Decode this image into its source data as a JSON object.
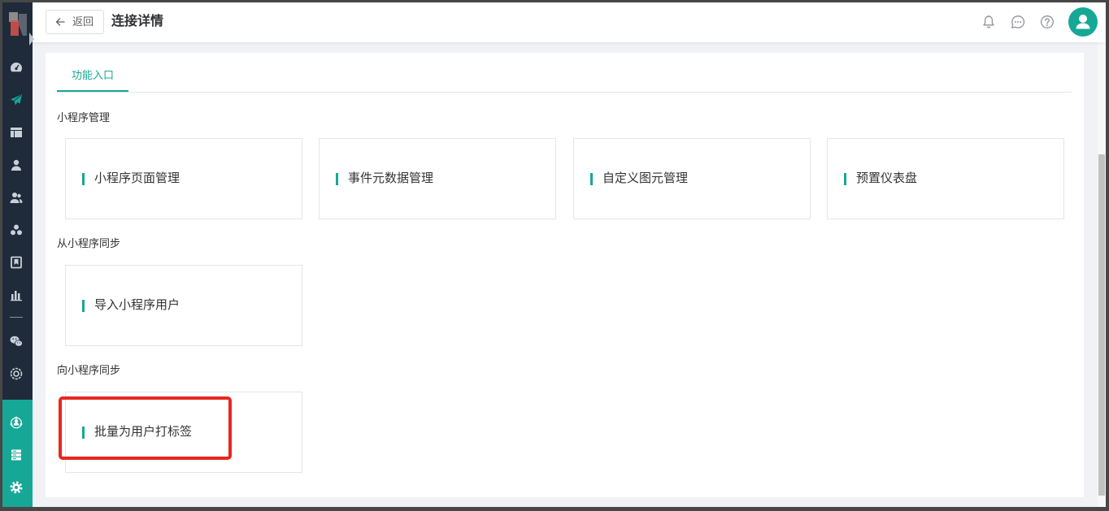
{
  "sidebar": {
    "nav_items": [
      {
        "icon": "dashboard-icon",
        "active": false
      },
      {
        "icon": "paper-plane-icon",
        "active": true
      },
      {
        "icon": "layout-icon",
        "active": false
      },
      {
        "icon": "user-icon",
        "active": false
      },
      {
        "icon": "users-icon",
        "active": false
      },
      {
        "icon": "cluster-icon",
        "active": false
      },
      {
        "icon": "bookmark-icon",
        "active": false
      },
      {
        "icon": "bar-chart-icon",
        "active": false
      },
      {
        "icon": "wechat-icon",
        "active": false
      },
      {
        "icon": "target-icon",
        "active": false
      }
    ],
    "bottom_items": [
      {
        "icon": "network-icon"
      },
      {
        "icon": "server-icon"
      },
      {
        "icon": "gear-icon"
      }
    ]
  },
  "header": {
    "back_label": "返回",
    "title": "连接详情",
    "actions": [
      {
        "icon": "bell-icon"
      },
      {
        "icon": "chat-icon"
      },
      {
        "icon": "help-icon"
      },
      {
        "icon": "avatar-icon"
      }
    ]
  },
  "tabs": [
    {
      "label": "功能入口",
      "active": true
    }
  ],
  "sections": [
    {
      "title": "小程序管理",
      "cards": [
        {
          "label": "小程序页面管理"
        },
        {
          "label": "事件元数据管理"
        },
        {
          "label": "自定义图元管理"
        },
        {
          "label": "预置仪表盘"
        }
      ]
    },
    {
      "title": "从小程序同步",
      "cards": [
        {
          "label": "导入小程序用户"
        }
      ]
    },
    {
      "title": "向小程序同步",
      "cards": [
        {
          "label": "批量为用户打标签"
        }
      ]
    }
  ],
  "colors": {
    "accent": "#17a797",
    "sidebar": "#1f2b3a",
    "highlight": "#e8271f",
    "page_bg": "#f0f2f5"
  }
}
